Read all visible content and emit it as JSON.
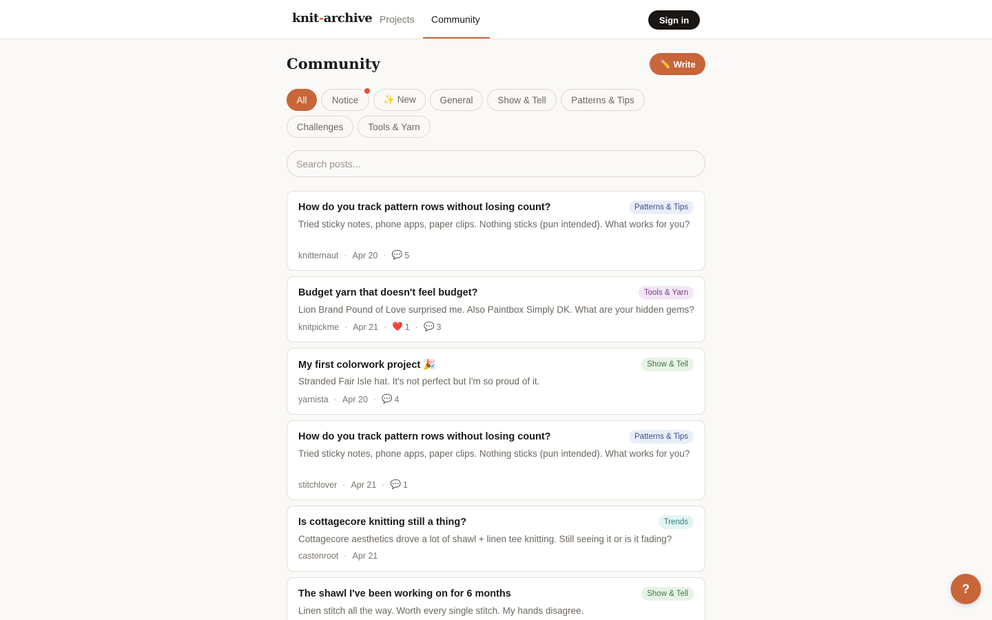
{
  "header": {
    "logo_main": "knit",
    "logo_sep": "-",
    "logo_rest": "archive",
    "nav": [
      "Projects",
      "Community"
    ],
    "signin": "Sign in"
  },
  "page": {
    "title": "Community",
    "write_icon": "✏️",
    "write_label": "Write"
  },
  "filters": [
    "All",
    "Notice",
    "✨ New",
    "General",
    "Show & Tell",
    "Patterns & Tips",
    "Challenges",
    "Tools & Yarn"
  ],
  "search": {
    "placeholder": "Search posts..."
  },
  "posts": [
    {
      "title": "How do you track pattern rows without losing count?",
      "tag": "Patterns & Tips",
      "excerpt": "Tried sticky notes, phone apps, paper clips. Nothing sticks (pun intended). What works for you?",
      "author": "knitternaut",
      "date": "Apr 20",
      "comments": "5"
    },
    {
      "title": "Budget yarn that doesn't feel budget?",
      "tag": "Tools & Yarn",
      "excerpt": "Lion Brand Pound of Love surprised me. Also Paintbox Simply DK. What are your hidden gems?",
      "author": "knitpickme",
      "date": "Apr 21",
      "likes": "1",
      "comments": "3"
    },
    {
      "title": "My first colorwork project",
      "title_emoji": "🎉",
      "tag": "Show & Tell",
      "excerpt": "Stranded Fair Isle hat. It's not perfect but I'm so proud of it.",
      "author": "yarnista",
      "date": "Apr 20",
      "comments": "4"
    },
    {
      "title": "How do you track pattern rows without losing count?",
      "tag": "Patterns & Tips",
      "excerpt": "Tried sticky notes, phone apps, paper clips. Nothing sticks (pun intended). What works for you?",
      "author": "stitchlover",
      "date": "Apr 21",
      "comments": "1"
    },
    {
      "title": "Is cottagecore knitting still a thing?",
      "tag": "Trends",
      "excerpt": "Cottagecore aesthetics drove a lot of shawl + linen tee knitting. Still seeing it or is it fading?",
      "author": "castonroot",
      "date": "Apr 21"
    },
    {
      "title": "The shawl I've been working on for 6 months",
      "tag": "Show & Tell",
      "excerpt": "Linen stitch all the way. Worth every single stitch. My hands disagree."
    }
  ],
  "icons": {
    "comment": "💬",
    "heart": "❤️",
    "sep": "·"
  },
  "help": {
    "label": "?"
  },
  "colors": {
    "accent": "#c8663a",
    "dark": "#1a1614",
    "notice_dot": "#e74c3c"
  }
}
